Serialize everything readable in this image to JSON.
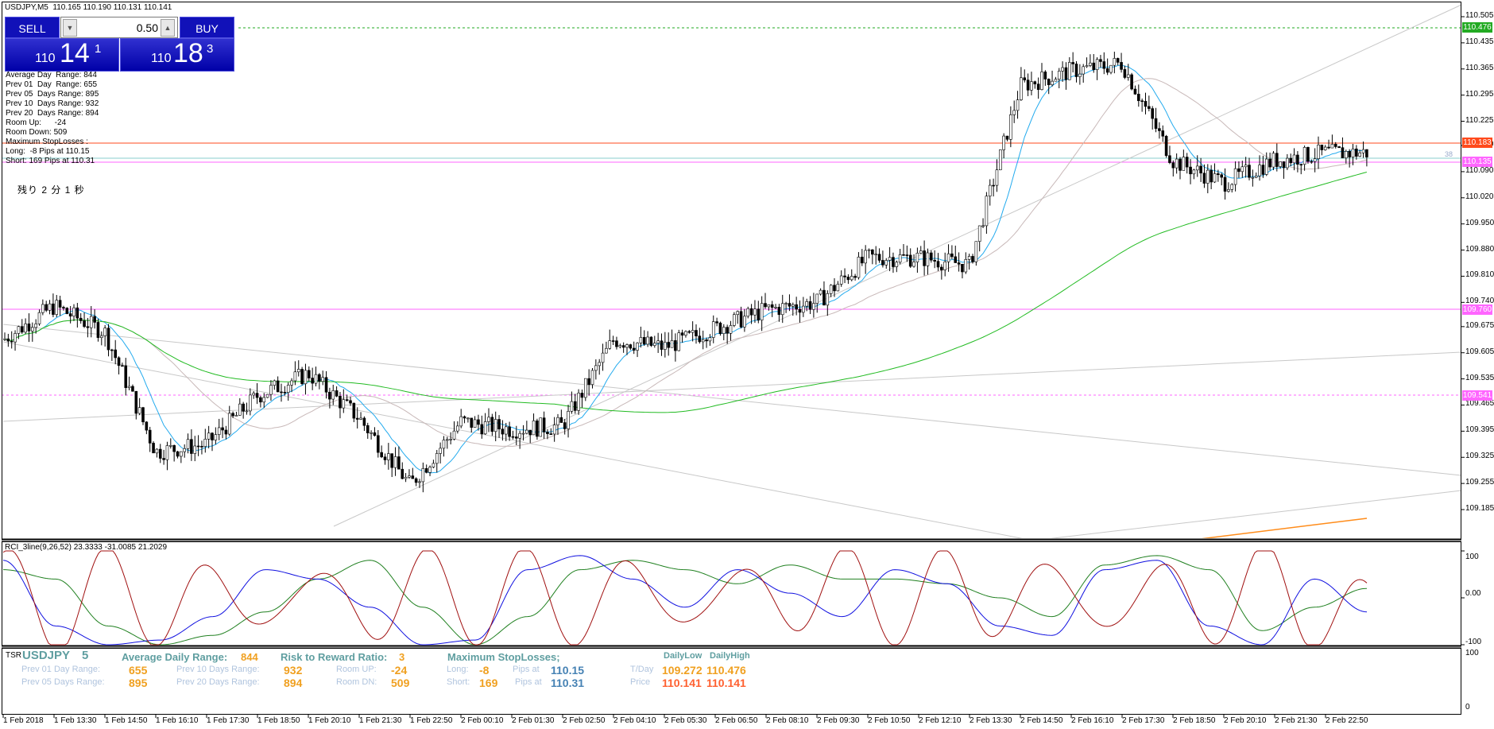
{
  "header": {
    "symbol_line": "USDJPY,M5  110.165 110.190 110.131 110.141"
  },
  "trade_panel": {
    "sell_label": "SELL",
    "buy_label": "BUY",
    "lot_value": "0.50",
    "sell_price": {
      "prefix": "110",
      "big": "14",
      "sup": "1"
    },
    "buy_price": {
      "prefix": "110",
      "big": "18",
      "sup": "3"
    }
  },
  "info_lines": [
    "Average Day  Range: 844",
    "Prev 01  Day  Range: 655",
    "Prev 05  Days Range: 895",
    "Prev 10  Days Range: 932",
    "Prev 20  Days Range: 894",
    "Room Up:      -24",
    "Room Down: 509",
    "Maximum StopLosses :",
    "Long:  -8 Pips at 110.15",
    "Short: 169 Pips at 110.31"
  ],
  "countdown": "残り 2 分 1 秒",
  "price_axis": {
    "labels": [
      "110.505",
      "110.435",
      "110.365",
      "110.295",
      "110.225",
      "110.160",
      "110.090",
      "110.020",
      "109.950",
      "109.880",
      "109.810",
      "109.740",
      "109.675",
      "109.605",
      "109.535",
      "109.465",
      "109.395",
      "109.325",
      "109.255",
      "109.185"
    ],
    "tags": [
      {
        "value": "110.476",
        "color": "#22aa22"
      },
      {
        "value": "110.183",
        "color": "#ff4a1c"
      },
      {
        "value": "110.135",
        "color": "#ff66ff"
      },
      {
        "value": "109.760",
        "color": "#ff66ff"
      },
      {
        "value": "109.541",
        "color": "#ff66ff"
      }
    ],
    "small_marker": "38"
  },
  "indicator": {
    "title": "RCI_3line(9,26,52) 23.3333 -31.0085 21.2029",
    "labels": [
      "100",
      "0.00",
      "-100"
    ],
    "colors": {
      "short": "#a01010",
      "mid": "#1010e0",
      "long": "#208020"
    }
  },
  "tsr_panel": {
    "tag": "TSR",
    "symbol": "USDJPY",
    "tf": "5",
    "adr_label": "Average Daily Range:",
    "adr_value": "844",
    "rr_label": "Risk to Reward Ratio:",
    "rr_value": "3",
    "msl_label": "Maximum StopLosses;",
    "daily_low_label": "DailyLow",
    "daily_high_label": "DailyHigh",
    "prev01_label": "Prev 01 Day Range:",
    "prev01_value": "655",
    "prev05_label": "Prev 05 Days Range:",
    "prev05_value": "895",
    "prev10_label": "Prev 10 Days Range:",
    "prev10_value": "932",
    "prev20_label": "Prev 20 Days Range:",
    "prev20_value": "894",
    "roomup_label": "Room UP:",
    "roomup_value": "-24",
    "roomdn_label": "Room DN:",
    "roomdn_value": "509",
    "long_label": "Long:",
    "long_value": "-8",
    "short_label": "Short:",
    "short_value": "169",
    "pips_at_label": "Pips at",
    "long_price": "110.15",
    "short_price": "110.31",
    "tday_label": "T/Day",
    "tday_low": "109.272",
    "tday_high": "110.476",
    "price_label": "Price",
    "price_low": "110.141",
    "price_high": "110.141",
    "sub_labels": [
      "100",
      "0"
    ]
  },
  "time_axis": [
    "1 Feb 2018",
    "1 Feb 13:30",
    "1 Feb 14:50",
    "1 Feb 16:10",
    "1 Feb 17:30",
    "1 Feb 18:50",
    "1 Feb 20:10",
    "1 Feb 21:30",
    "1 Feb 22:50",
    "2 Feb 00:10",
    "2 Feb 01:30",
    "2 Feb 02:50",
    "2 Feb 04:10",
    "2 Feb 05:30",
    "2 Feb 06:50",
    "2 Feb 08:10",
    "2 Feb 09:30",
    "2 Feb 10:50",
    "2 Feb 12:10",
    "2 Feb 13:30",
    "2 Feb 14:50",
    "2 Feb 16:10",
    "2 Feb 17:30",
    "2 Feb 18:50",
    "2 Feb 20:10",
    "2 Feb 21:30",
    "2 Feb 22:50"
  ],
  "chart_data": {
    "type": "candlestick",
    "symbol": "USDJPY",
    "timeframe": "M5",
    "ylim": [
      109.185,
      110.505
    ],
    "close_path": [
      {
        "x": "1 Feb 2018",
        "y": 109.64
      },
      {
        "x": "1 Feb 13:30",
        "y": 109.73
      },
      {
        "x": "1 Feb 14:50",
        "y": 109.66
      },
      {
        "x": "1 Feb 16:10",
        "y": 109.34
      },
      {
        "x": "1 Feb 17:30",
        "y": 109.36
      },
      {
        "x": "1 Feb 18:50",
        "y": 109.49
      },
      {
        "x": "1 Feb 20:10",
        "y": 109.55
      },
      {
        "x": "1 Feb 21:30",
        "y": 109.43
      },
      {
        "x": "1 Feb 22:50",
        "y": 109.25
      },
      {
        "x": "2 Feb 00:10",
        "y": 109.42
      },
      {
        "x": "2 Feb 01:30",
        "y": 109.4
      },
      {
        "x": "2 Feb 02:50",
        "y": 109.41
      },
      {
        "x": "2 Feb 04:10",
        "y": 109.64
      },
      {
        "x": "2 Feb 05:30",
        "y": 109.62
      },
      {
        "x": "2 Feb 06:50",
        "y": 109.67
      },
      {
        "x": "2 Feb 08:10",
        "y": 109.72
      },
      {
        "x": "2 Feb 09:30",
        "y": 109.74
      },
      {
        "x": "2 Feb 10:50",
        "y": 109.86
      },
      {
        "x": "2 Feb 12:10",
        "y": 109.86
      },
      {
        "x": "2 Feb 13:30",
        "y": 109.84
      },
      {
        "x": "2 Feb 14:50",
        "y": 110.32
      },
      {
        "x": "2 Feb 16:10",
        "y": 110.36
      },
      {
        "x": "2 Feb 17:30",
        "y": 110.38
      },
      {
        "x": "2 Feb 18:50",
        "y": 110.12
      },
      {
        "x": "2 Feb 20:10",
        "y": 110.06
      },
      {
        "x": "2 Feb 21:30",
        "y": 110.12
      },
      {
        "x": "2 Feb 22:50",
        "y": 110.14
      }
    ],
    "rci": {
      "short": [
        100,
        -100,
        90,
        -95,
        80,
        -90,
        85,
        -100,
        95,
        -80,
        90,
        -100,
        100,
        -90,
        85,
        -70,
        95,
        -80,
        90,
        -85,
        100,
        -100,
        90,
        -95,
        100,
        -90,
        20
      ],
      "mid": [
        80,
        -60,
        -100,
        -90,
        -40,
        60,
        40,
        -20,
        -100,
        -90,
        60,
        90,
        40,
        -20,
        60,
        10,
        -40,
        60,
        30,
        -60,
        -80,
        60,
        80,
        -60,
        -100,
        40,
        -30
      ],
      "long": [
        60,
        40,
        -60,
        -100,
        -80,
        -30,
        40,
        80,
        -20,
        -100,
        -40,
        60,
        80,
        60,
        30,
        70,
        40,
        40,
        30,
        0,
        -40,
        70,
        90,
        60,
        -70,
        -20,
        20
      ]
    }
  }
}
